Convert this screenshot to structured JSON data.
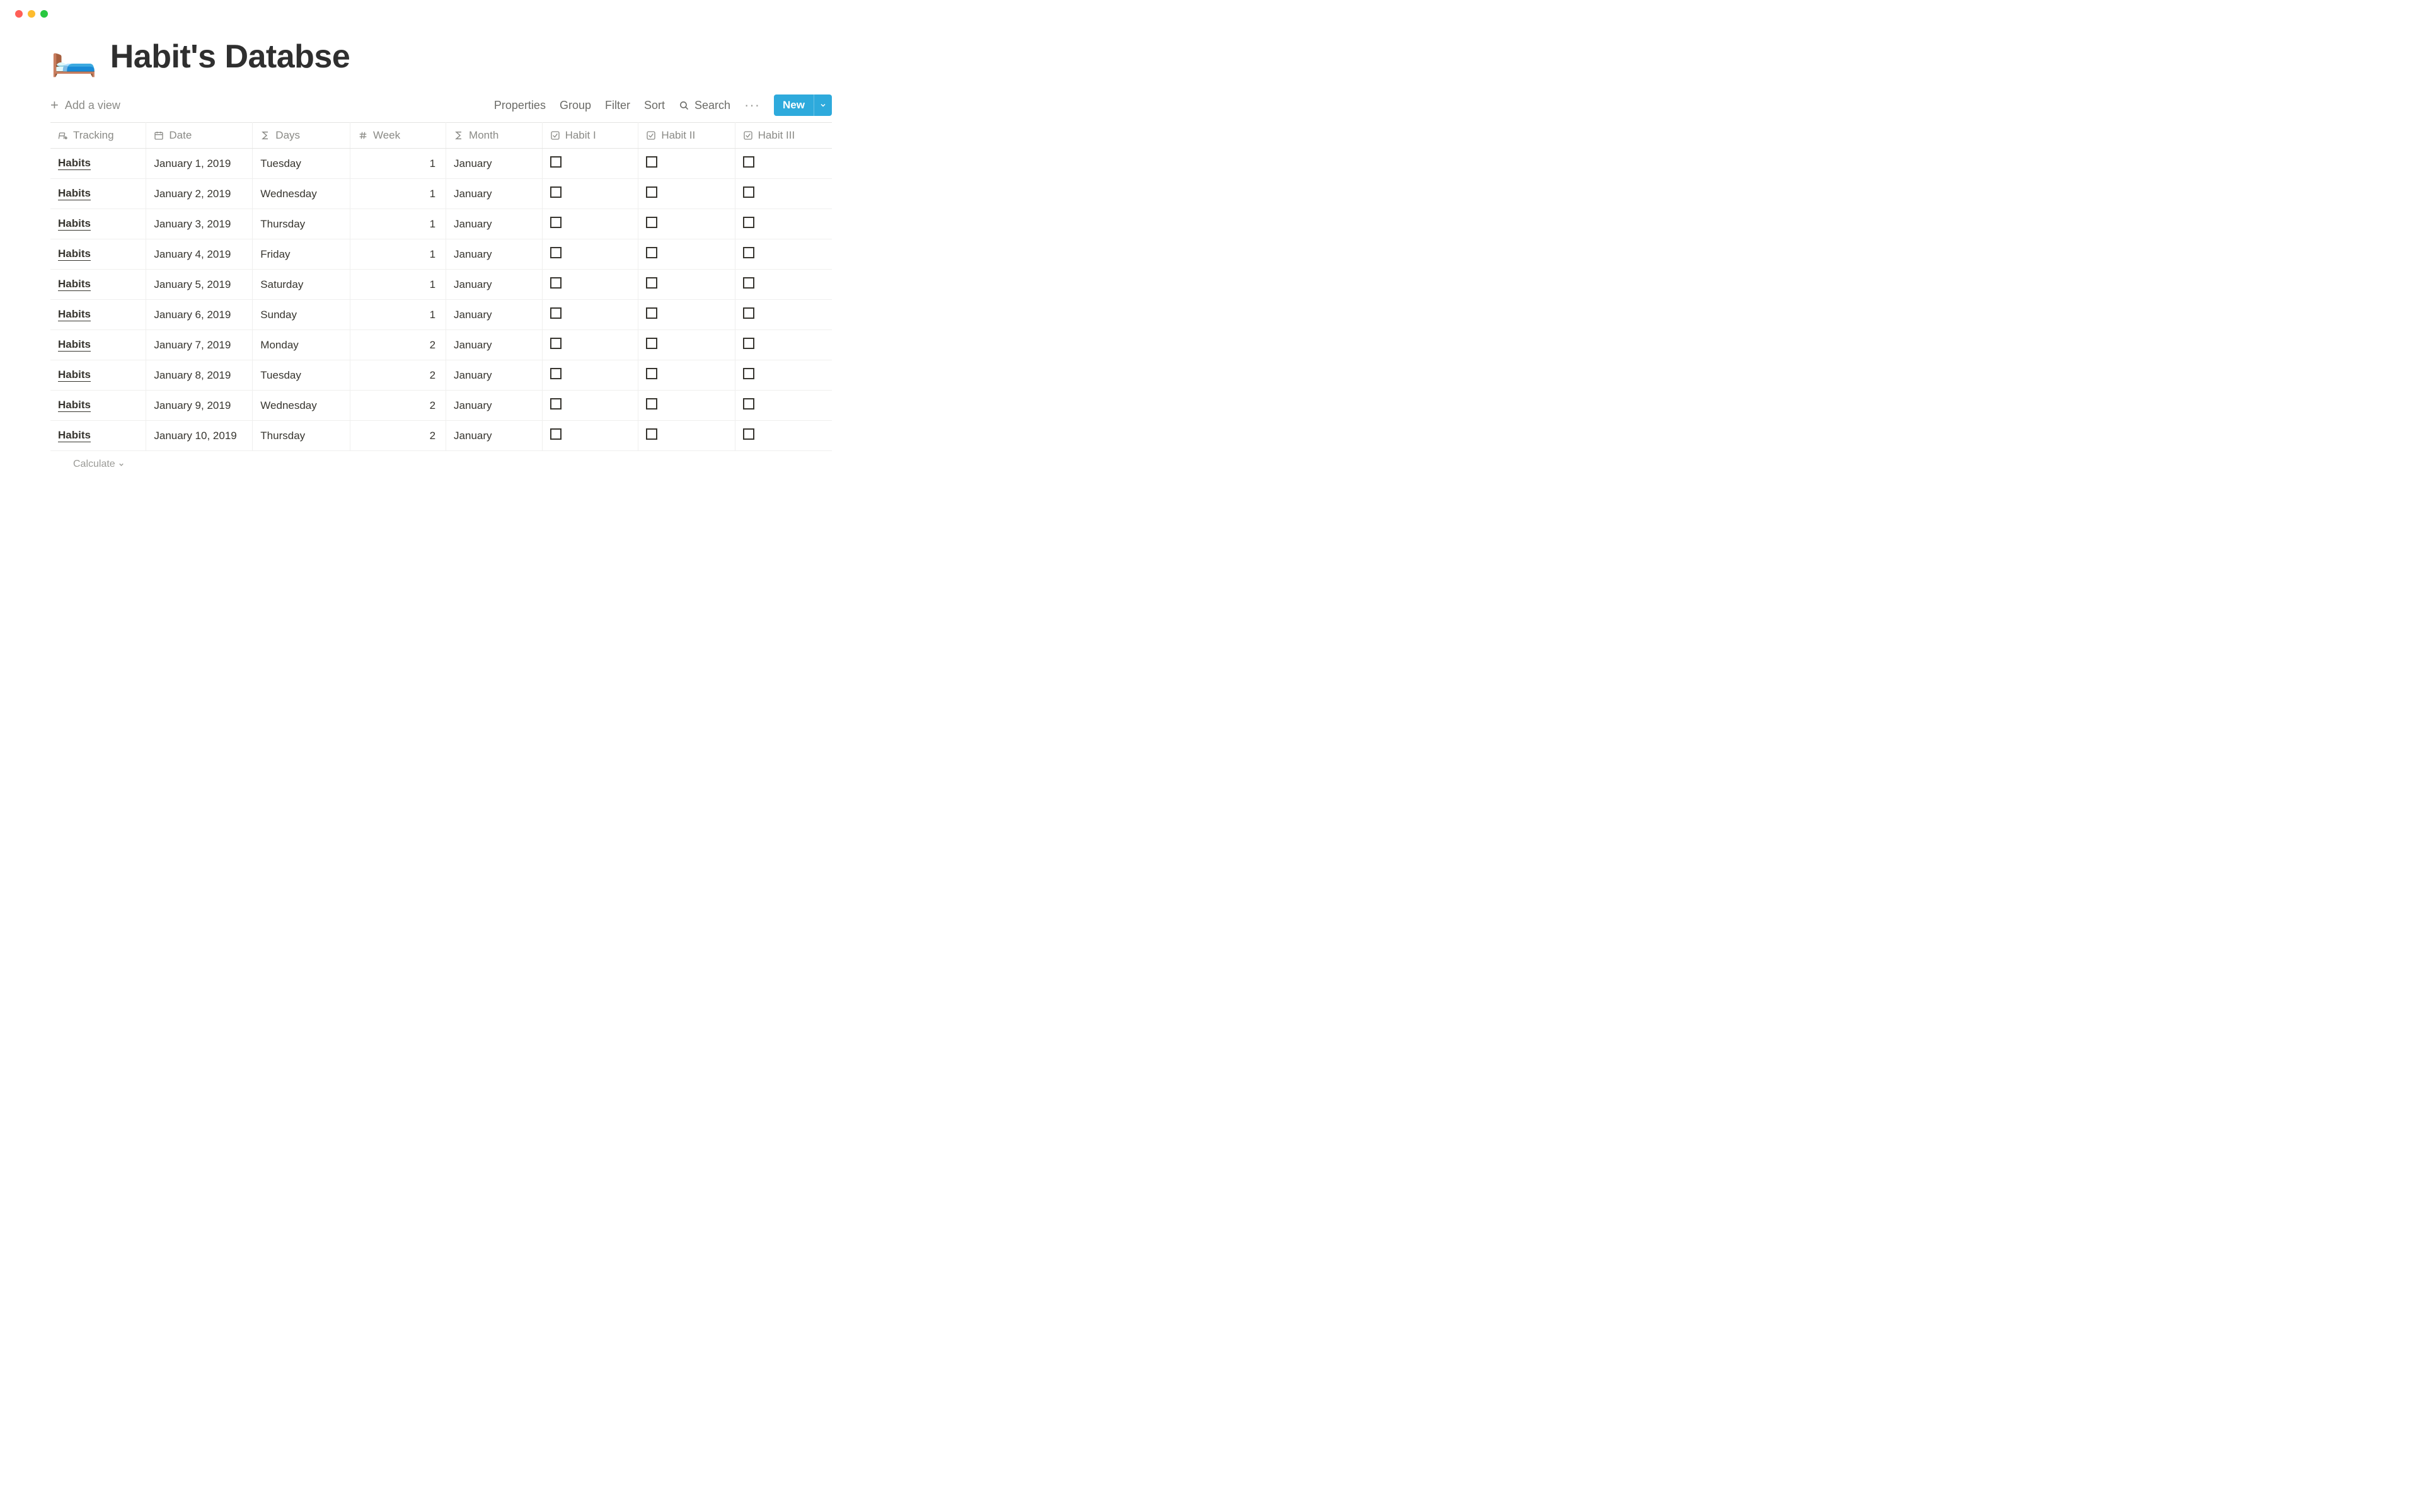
{
  "window": {
    "icon_emoji": "🛏️",
    "title": "Habit's Databse"
  },
  "toolbar": {
    "add_view_label": "Add a view",
    "properties_label": "Properties",
    "group_label": "Group",
    "filter_label": "Filter",
    "sort_label": "Sort",
    "search_label": "Search",
    "new_label": "New"
  },
  "columns": {
    "tracking": "Tracking",
    "date": "Date",
    "days": "Days",
    "week": "Week",
    "month": "Month",
    "habit1": "Habit I",
    "habit2": "Habit II",
    "habit3": "Habit III"
  },
  "rows": [
    {
      "tracking": "Habits",
      "date": "January 1, 2019",
      "days": "Tuesday",
      "week": "1",
      "month": "January",
      "h1": false,
      "h2": false,
      "h3": false
    },
    {
      "tracking": "Habits",
      "date": "January 2, 2019",
      "days": "Wednesday",
      "week": "1",
      "month": "January",
      "h1": false,
      "h2": false,
      "h3": false
    },
    {
      "tracking": "Habits",
      "date": "January 3, 2019",
      "days": "Thursday",
      "week": "1",
      "month": "January",
      "h1": false,
      "h2": false,
      "h3": false
    },
    {
      "tracking": "Habits",
      "date": "January 4, 2019",
      "days": "Friday",
      "week": "1",
      "month": "January",
      "h1": false,
      "h2": false,
      "h3": false
    },
    {
      "tracking": "Habits",
      "date": "January 5, 2019",
      "days": "Saturday",
      "week": "1",
      "month": "January",
      "h1": false,
      "h2": false,
      "h3": false
    },
    {
      "tracking": "Habits",
      "date": "January 6, 2019",
      "days": "Sunday",
      "week": "1",
      "month": "January",
      "h1": false,
      "h2": false,
      "h3": false
    },
    {
      "tracking": "Habits",
      "date": "January 7, 2019",
      "days": "Monday",
      "week": "2",
      "month": "January",
      "h1": false,
      "h2": false,
      "h3": false
    },
    {
      "tracking": "Habits",
      "date": "January 8, 2019",
      "days": "Tuesday",
      "week": "2",
      "month": "January",
      "h1": false,
      "h2": false,
      "h3": false
    },
    {
      "tracking": "Habits",
      "date": "January 9, 2019",
      "days": "Wednesday",
      "week": "2",
      "month": "January",
      "h1": false,
      "h2": false,
      "h3": false
    },
    {
      "tracking": "Habits",
      "date": "January 10, 2019",
      "days": "Thursday",
      "week": "2",
      "month": "January",
      "h1": false,
      "h2": false,
      "h3": false
    }
  ],
  "footer": {
    "calculate_label": "Calculate"
  }
}
